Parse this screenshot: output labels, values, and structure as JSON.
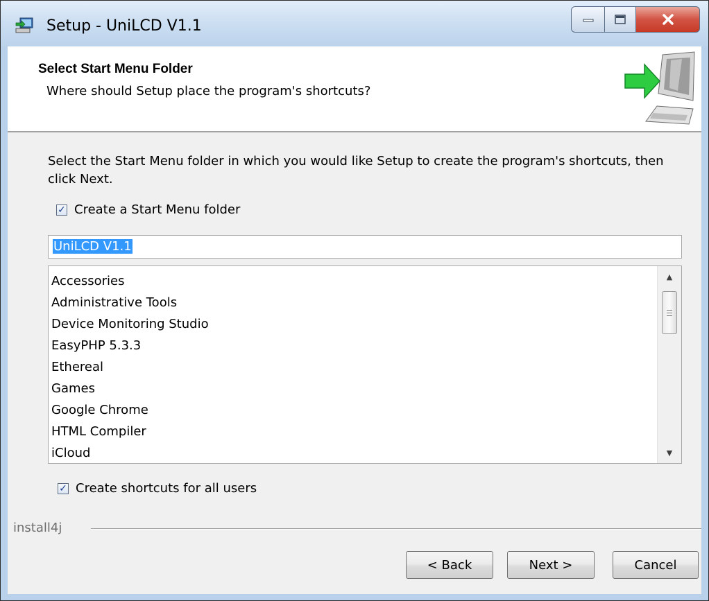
{
  "window": {
    "title": "Setup - UniLCD V1.1",
    "icons": [
      "setup-computer-icon",
      "minimize-icon",
      "maximize-icon",
      "close-icon"
    ]
  },
  "header": {
    "title": "Select Start Menu Folder",
    "subtitle": "Where should Setup place the program's shortcuts?",
    "image": "computer-with-green-arrow-icon"
  },
  "main": {
    "instructions": "Select the Start Menu folder in which you would like Setup to create the program's shortcuts, then click Next.",
    "create_folder": {
      "label": "Create a Start Menu folder",
      "checked": true
    },
    "folder_name": "UniLCD V1.1",
    "folders": [
      "Accessories",
      "Administrative Tools",
      "Device Monitoring Studio",
      "EasyPHP 5.3.3",
      "Ethereal",
      "Games",
      "Google Chrome",
      "HTML Compiler",
      "iCloud"
    ],
    "all_users": {
      "label": "Create shortcuts for all users",
      "checked": true
    }
  },
  "footer": {
    "brand": "install4j",
    "back_label": "< Back",
    "next_label": "Next >",
    "cancel_label": "Cancel"
  },
  "colors": {
    "selection": "#3399ff",
    "close_button": "#c63a27",
    "arrow_green": "#2ecc40"
  }
}
